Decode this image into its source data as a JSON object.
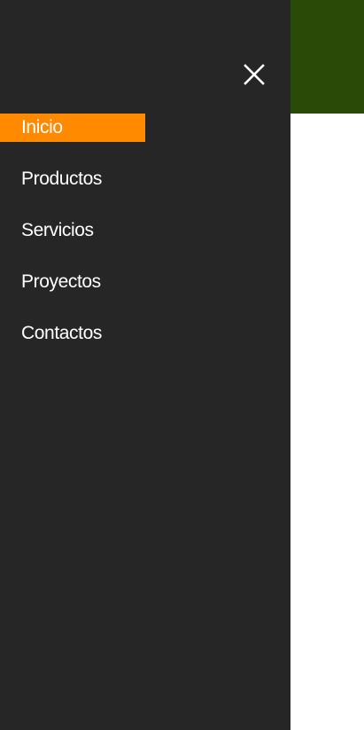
{
  "colors": {
    "drawer_background": "#262626",
    "header_background": "#2a4a08",
    "active_item_background": "#ff8a00",
    "text": "#ffffff",
    "page_background": "#ffffff"
  },
  "drawer": {
    "close_icon": "close-icon",
    "menu": [
      {
        "label": "Inicio",
        "active": true
      },
      {
        "label": "Productos",
        "active": false
      },
      {
        "label": "Servicios",
        "active": false
      },
      {
        "label": "Proyectos",
        "active": false
      },
      {
        "label": "Contactos",
        "active": false
      }
    ]
  }
}
